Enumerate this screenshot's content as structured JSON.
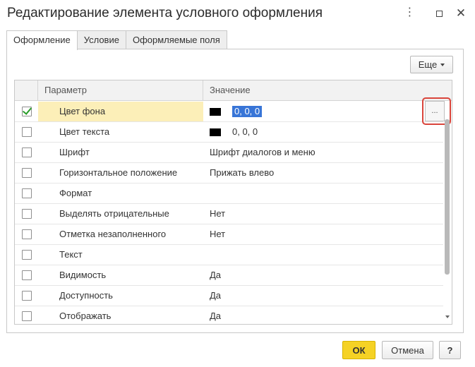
{
  "window": {
    "title": "Редактирование элемента условного оформления",
    "more_icon": "⋮",
    "close_icon": "✕"
  },
  "tabs": [
    {
      "label": "Оформление"
    },
    {
      "label": "Условие"
    },
    {
      "label": "Оформляемые поля"
    }
  ],
  "toolbar": {
    "more_label": "Еще"
  },
  "grid": {
    "headers": {
      "param": "Параметр",
      "value": "Значение"
    },
    "rows": [
      {
        "param": "Цвет фона",
        "value": "0, 0, 0",
        "checked": true
      },
      {
        "param": "Цвет текста",
        "value": "0, 0, 0",
        "checked": false
      },
      {
        "param": "Шрифт",
        "value": "Шрифт диалогов и меню",
        "checked": false
      },
      {
        "param": "Горизонтальное положение",
        "value": "Прижать влево",
        "checked": false
      },
      {
        "param": "Формат",
        "value": "",
        "checked": false
      },
      {
        "param": "Выделять отрицательные",
        "value": "Нет",
        "checked": false
      },
      {
        "param": "Отметка незаполненного",
        "value": "Нет",
        "checked": false
      },
      {
        "param": "Текст",
        "value": "",
        "checked": false
      },
      {
        "param": "Видимость",
        "value": "Да",
        "checked": false
      },
      {
        "param": "Доступность",
        "value": "Да",
        "checked": false
      },
      {
        "param": "Отображать",
        "value": "Да",
        "checked": false
      }
    ],
    "ellipsis_label": "..."
  },
  "footer": {
    "ok_label": "ОК",
    "cancel_label": "Отмена",
    "help_label": "?"
  },
  "colors": {
    "accent": "#f5d225",
    "selection": "#3875d7",
    "highlight": "#d9443b",
    "selected_row": "#fcefb8"
  }
}
